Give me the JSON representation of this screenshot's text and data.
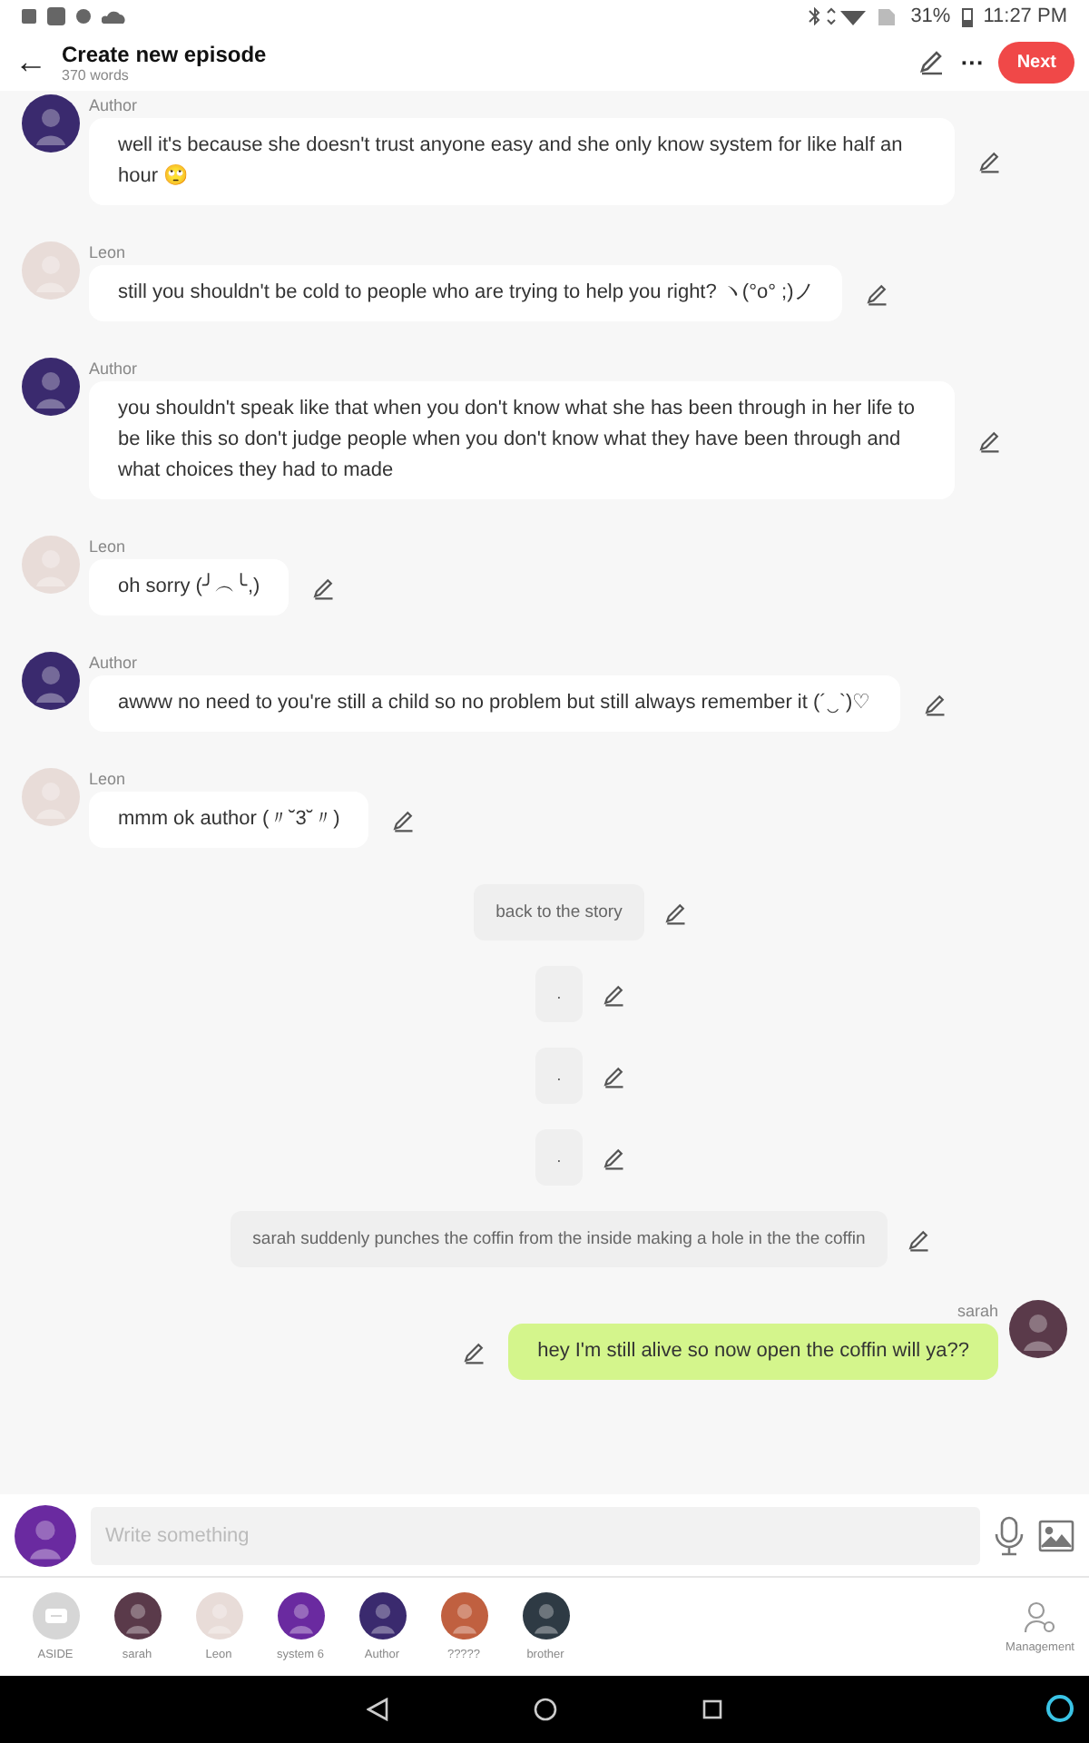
{
  "status_bar": {
    "battery": "31%",
    "time": "11:27 PM"
  },
  "header": {
    "back": "←",
    "title": "Create new episode",
    "subtitle": "370 words",
    "more": "···",
    "next_button": "Next"
  },
  "messages": [
    {
      "kind": "left",
      "speaker": "Author",
      "color": "#3a2a6e",
      "text": "well it's because she doesn't trust anyone easy and she only know system for like half an hour 🙄"
    },
    {
      "kind": "left",
      "speaker": "Leon",
      "color": "#e8dcd8",
      "text": "still you shouldn't be cold to people who are trying to help you right? ヽ(°o° ;)ノ"
    },
    {
      "kind": "left",
      "speaker": "Author",
      "color": "#3a2a6e",
      "text": "you shouldn't speak like that when you don't know what she has been through in her life  to be like this so don't judge people when you don't know  what they have been through and what choices they had to made"
    },
    {
      "kind": "left",
      "speaker": "Leon",
      "color": "#e8dcd8",
      "text": "oh sorry (╯︵╰,)"
    },
    {
      "kind": "left",
      "speaker": "Author",
      "color": "#3a2a6e",
      "text": "awww no need to you're still a child so no problem but still always remember it (´‿`)♡"
    },
    {
      "kind": "left",
      "speaker": "Leon",
      "color": "#e8dcd8",
      "text": "mmm  ok author (〃˘3˘〃)"
    },
    {
      "kind": "aside",
      "text": "back to the story"
    },
    {
      "kind": "aside",
      "text": "."
    },
    {
      "kind": "aside",
      "text": "."
    },
    {
      "kind": "aside",
      "text": "."
    },
    {
      "kind": "aside",
      "text": "sarah suddenly punches the coffin from the inside making a hole in the the coffin"
    },
    {
      "kind": "right",
      "speaker": "sarah",
      "color": "#5a3a4a",
      "text": "hey I'm still alive so now open the coffin will ya??"
    }
  ],
  "composer": {
    "color": "#6a2aa0",
    "placeholder": "Write something"
  },
  "characters": [
    {
      "kind": "aside",
      "name": "ASIDE",
      "color": "#d6d6d6"
    },
    {
      "kind": "avatar",
      "name": "sarah",
      "color": "#5a3a4a"
    },
    {
      "kind": "avatar",
      "name": "Leon",
      "color": "#e8dcd8"
    },
    {
      "kind": "avatar",
      "name": "system 6",
      "color": "#6a2aa0"
    },
    {
      "kind": "avatar",
      "name": "Author",
      "color": "#3a2a6e"
    },
    {
      "kind": "avatar",
      "name": "?????",
      "color": "#c06040"
    },
    {
      "kind": "avatar",
      "name": "brother",
      "color": "#2e3a44"
    }
  ],
  "management": "Management"
}
